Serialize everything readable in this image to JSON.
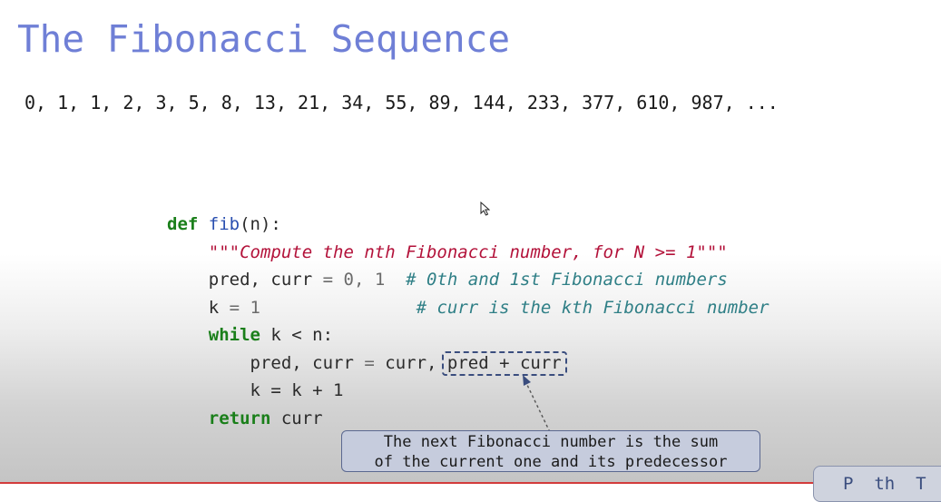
{
  "slide": {
    "title": "The Fibonacci Sequence",
    "sequence": "0, 1, 1, 2, 3, 5, 8, 13, 21, 34, 55, 89, 144, 233, 377, 610, 987, ..."
  },
  "code": {
    "line1": {
      "kw": "def",
      "name": "fib",
      "rest": "(n):"
    },
    "line2": {
      "docstring": "\"\"\"Compute the nth Fibonacci number, for N >= 1\"\"\""
    },
    "line3": {
      "code_a": "pred, curr ",
      "eq": "=",
      "code_b": " 0, 1",
      "comment": "# 0th and 1st Fibonacci numbers"
    },
    "line4": {
      "code_a": "k ",
      "eq": "=",
      "code_b": " 1",
      "comment": "# curr is the kth Fibonacci number"
    },
    "line5": {
      "kw": "while",
      "rest": " k < n:"
    },
    "line6": {
      "code_a": "pred, curr ",
      "eq": "=",
      "code_b": " curr, ",
      "highlight": "pred + curr"
    },
    "line7": {
      "code": "k = k + 1"
    },
    "line8": {
      "kw": "return",
      "rest": " curr"
    }
  },
  "callout": {
    "line1": "The next Fibonacci number is the sum",
    "line2": "of the current one and its predecessor"
  },
  "corner_widget": {
    "text": "P  th  T"
  }
}
